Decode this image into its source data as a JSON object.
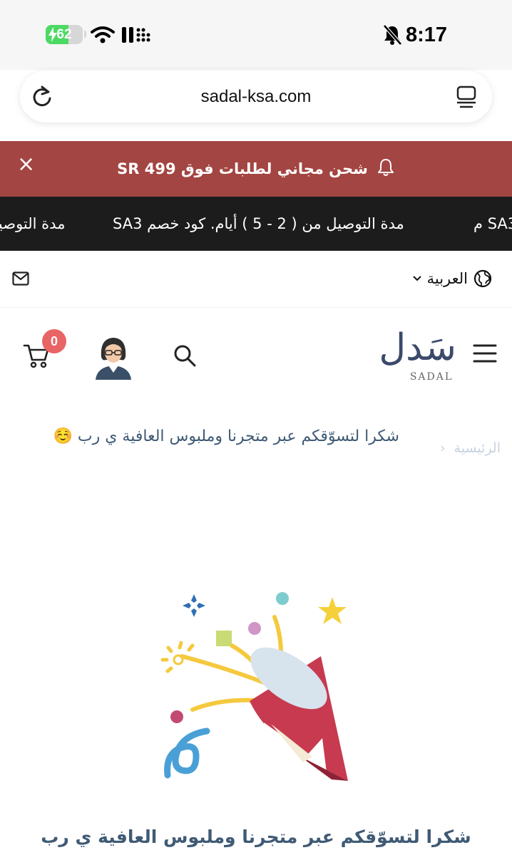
{
  "status_bar": {
    "battery": "62",
    "battery_level": 0.62,
    "time": "8:17"
  },
  "browser": {
    "url": "sadal-ksa.com"
  },
  "promo_banner": {
    "text": "شحن مجاني لطلبات فوق 499 SR",
    "close": "×"
  },
  "ticker": {
    "message": "مدة التوصيل من ( 2 - 5 ) أيام. كود خصم SA3",
    "partial_left": "مدة التوصيل",
    "partial_right": "SA3 م"
  },
  "topbar": {
    "language": "العربية"
  },
  "header": {
    "cart_count": "0",
    "logo_arabic": "سَدل",
    "logo_english": "SADAL"
  },
  "breadcrumb": {
    "home": "الرئيسية",
    "separator": "‹"
  },
  "page": {
    "heading": "شكرا لتسوّقكم عبر متجرنا وملبوس العافية ي رب ☺️",
    "thank_you": "شكرا لتسوّقكم عبر متجرنا وملبوس العافية ي رب"
  },
  "colors": {
    "banner": "#a34542",
    "ticker": "#1c1c1c",
    "badge": "#e96465",
    "heading": "#3f5a75"
  }
}
